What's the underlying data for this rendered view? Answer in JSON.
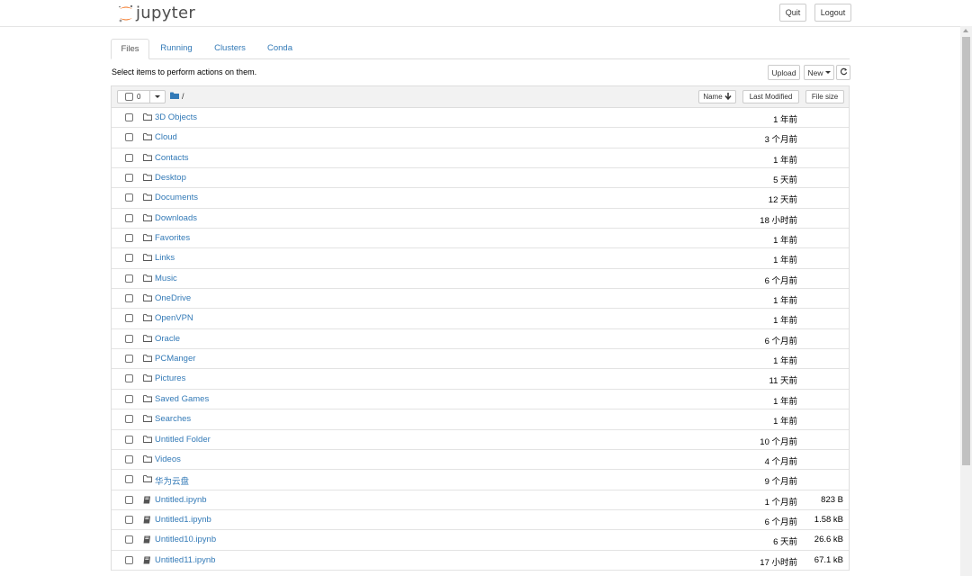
{
  "header": {
    "logo_text": "jupyter",
    "quit_label": "Quit",
    "logout_label": "Logout"
  },
  "tabs": [
    {
      "label": "Files",
      "active": true
    },
    {
      "label": "Running",
      "active": false
    },
    {
      "label": "Clusters",
      "active": false
    },
    {
      "label": "Conda",
      "active": false
    }
  ],
  "toolbar": {
    "instruction": "Select items to perform actions on them.",
    "upload_label": "Upload",
    "new_label": "New"
  },
  "list_header": {
    "selected_count": "0",
    "path": "/",
    "name_label": "Name",
    "last_modified_label": "Last Modified",
    "file_size_label": "File size"
  },
  "files": [
    {
      "name": "3D Objects",
      "type": "folder",
      "modified": "1 年前",
      "size": ""
    },
    {
      "name": "Cloud",
      "type": "folder",
      "modified": "3 个月前",
      "size": ""
    },
    {
      "name": "Contacts",
      "type": "folder",
      "modified": "1 年前",
      "size": ""
    },
    {
      "name": "Desktop",
      "type": "folder",
      "modified": "5 天前",
      "size": ""
    },
    {
      "name": "Documents",
      "type": "folder",
      "modified": "12 天前",
      "size": ""
    },
    {
      "name": "Downloads",
      "type": "folder",
      "modified": "18 小时前",
      "size": ""
    },
    {
      "name": "Favorites",
      "type": "folder",
      "modified": "1 年前",
      "size": ""
    },
    {
      "name": "Links",
      "type": "folder",
      "modified": "1 年前",
      "size": ""
    },
    {
      "name": "Music",
      "type": "folder",
      "modified": "6 个月前",
      "size": ""
    },
    {
      "name": "OneDrive",
      "type": "folder",
      "modified": "1 年前",
      "size": ""
    },
    {
      "name": "OpenVPN",
      "type": "folder",
      "modified": "1 年前",
      "size": ""
    },
    {
      "name": "Oracle",
      "type": "folder",
      "modified": "6 个月前",
      "size": ""
    },
    {
      "name": "PCManger",
      "type": "folder",
      "modified": "1 年前",
      "size": ""
    },
    {
      "name": "Pictures",
      "type": "folder",
      "modified": "11 天前",
      "size": ""
    },
    {
      "name": "Saved Games",
      "type": "folder",
      "modified": "1 年前",
      "size": ""
    },
    {
      "name": "Searches",
      "type": "folder",
      "modified": "1 年前",
      "size": ""
    },
    {
      "name": "Untitled Folder",
      "type": "folder",
      "modified": "10 个月前",
      "size": ""
    },
    {
      "name": "Videos",
      "type": "folder",
      "modified": "4 个月前",
      "size": ""
    },
    {
      "name": "华为云盘",
      "type": "folder",
      "modified": "9 个月前",
      "size": ""
    },
    {
      "name": "Untitled.ipynb",
      "type": "notebook",
      "modified": "1 个月前",
      "size": "823 B"
    },
    {
      "name": "Untitled1.ipynb",
      "type": "notebook",
      "modified": "6 个月前",
      "size": "1.58 kB"
    },
    {
      "name": "Untitled10.ipynb",
      "type": "notebook",
      "modified": "6 天前",
      "size": "26.6 kB"
    },
    {
      "name": "Untitled11.ipynb",
      "type": "notebook",
      "modified": "17 小时前",
      "size": "67.1 kB"
    }
  ],
  "colors": {
    "link": "#337ab7",
    "logo_orange": "#f37726",
    "header_bg": "#f2f2f2"
  },
  "icons": {
    "folder": "folder-icon",
    "notebook": "notebook-icon",
    "refresh": "refresh-icon",
    "sort": "arrow-down-icon"
  }
}
